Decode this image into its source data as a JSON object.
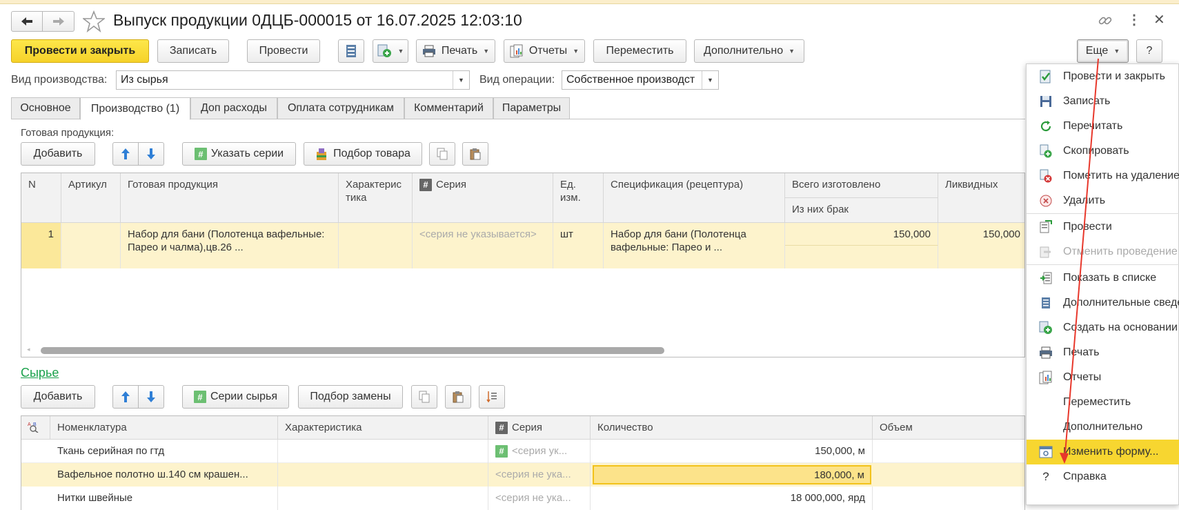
{
  "window": {
    "title": "Выпуск продукции 0ДЦБ-000015 от 16.07.2025 12:03:10"
  },
  "toolbar": {
    "post_and_close": "Провести и закрыть",
    "save": "Записать",
    "post": "Провести",
    "print": "Печать",
    "reports": "Отчеты",
    "move": "Переместить",
    "more_actions": "Дополнительно",
    "eshe": "Еще",
    "help": "?"
  },
  "form": {
    "prod_type_label": "Вид производства:",
    "prod_type_value": "Из сырья",
    "op_type_label": "Вид операции:",
    "op_type_value": "Собственное производст"
  },
  "tabs": [
    {
      "label": "Основное"
    },
    {
      "label": "Производство (1)"
    },
    {
      "label": "Доп расходы"
    },
    {
      "label": "Оплата сотрудникам"
    },
    {
      "label": "Комментарий"
    },
    {
      "label": "Параметры"
    }
  ],
  "finished": {
    "section_label": "Готовая продукция:",
    "add": "Добавить",
    "set_series": "Указать серии",
    "pick_goods": "Подбор товара",
    "columns": {
      "n": "N",
      "article": "Артикул",
      "product": "Готовая продукция",
      "characteristic": "Характеристика",
      "series": "Серия",
      "unit": "Ед. изм.",
      "spec": "Спецификация (рецептура)",
      "total": "Всего изготовлено",
      "defect": "Из них брак",
      "liquid": "Ликвидных"
    },
    "rows": [
      {
        "n": "1",
        "article": "",
        "product": "Набор для бани (Полотенца вафельные: Парео и чалма),цв.26 ...",
        "characteristic": "",
        "series": "<серия не указывается>",
        "unit": "шт",
        "spec": "Набор для бани (Полотенца вафельные: Парео и ...",
        "total": "150,000",
        "defect": "",
        "liquid": "150,000"
      }
    ]
  },
  "raw": {
    "section_label": "Сырье",
    "add": "Добавить",
    "raw_series": "Серии сырья",
    "replace": "Подбор замены",
    "columns": {
      "nomenclature": "Номенклатура",
      "characteristic": "Характеристика",
      "series": "Серия",
      "quantity": "Количество",
      "volume": "Объем"
    },
    "rows": [
      {
        "name": "Ткань серийная по гтд",
        "characteristic": "",
        "series": "<серия ук...",
        "quantity": "150,000, м"
      },
      {
        "name": "Вафельное полотно ш.140 см крашен...",
        "characteristic": "",
        "series": "<серия не ука...",
        "quantity": "180,000, м"
      },
      {
        "name": "Нитки швейные",
        "characteristic": "",
        "series": "<серия не ука...",
        "quantity": "18 000,000, ярд"
      }
    ]
  },
  "menu": {
    "items": [
      {
        "label": "Провести и закрыть",
        "icon": "post-close-icon"
      },
      {
        "label": "Записать",
        "icon": "save-icon"
      },
      {
        "label": "Перечитать",
        "icon": "refresh-icon"
      },
      {
        "label": "Скопировать",
        "icon": "copy-icon"
      },
      {
        "label": "Пометить на удаление",
        "icon": "mark-delete-icon"
      },
      {
        "label": "Удалить",
        "icon": "delete-icon"
      },
      {
        "label": "Провести",
        "icon": "post-icon"
      },
      {
        "label": "Отменить проведение",
        "icon": "unpost-icon"
      },
      {
        "label": "Показать в списке",
        "icon": "show-in-list-icon"
      },
      {
        "label": "Дополнительные сведения",
        "icon": "extra-info-icon"
      },
      {
        "label": "Создать на основании",
        "icon": "create-based-icon"
      },
      {
        "label": "Печать",
        "icon": "printer-icon"
      },
      {
        "label": "Отчеты",
        "icon": "reports-icon"
      },
      {
        "label": "Переместить",
        "icon": ""
      },
      {
        "label": "Дополнительно",
        "icon": ""
      },
      {
        "label": "Изменить форму...",
        "icon": "change-form-icon"
      },
      {
        "label": "Справка",
        "icon": "help-icon"
      }
    ]
  },
  "colors": {
    "accent_yellow": "#f7d630",
    "row_highlight": "#fdf3cc",
    "link_green": "#1aa14b",
    "annotation_red": "#e8372b"
  }
}
